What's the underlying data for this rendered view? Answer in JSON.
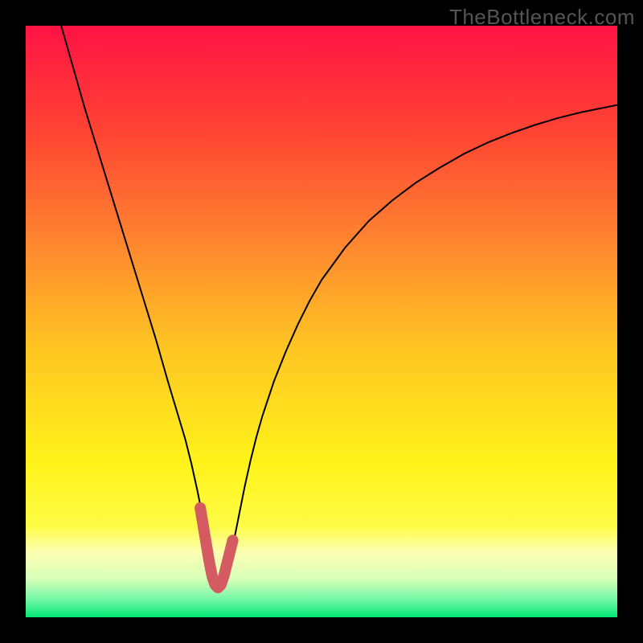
{
  "watermark": "TheBottleneck.com",
  "chart_data": {
    "type": "line",
    "title": "",
    "xlabel": "",
    "ylabel": "",
    "xlim": [
      0,
      100
    ],
    "ylim": [
      0,
      100
    ],
    "grid": false,
    "legend": false,
    "series": [
      {
        "name": "curve",
        "color": "#000000",
        "stroke_width": 2,
        "x": [
          6,
          8,
          10,
          12,
          14,
          16,
          18,
          20,
          22,
          24,
          25.8,
          27,
          28,
          29,
          30,
          30.8,
          31.6,
          32.4,
          33.2,
          34,
          35,
          36,
          37,
          38,
          39,
          40,
          42,
          44,
          46,
          48,
          50,
          54,
          58,
          62,
          66,
          70,
          74,
          78,
          82,
          86,
          90,
          94,
          98,
          100
        ],
        "y": [
          100,
          93,
          86,
          79.5,
          73,
          66.5,
          60,
          53.5,
          47,
          40,
          34,
          30,
          26,
          21.5,
          16.5,
          11.5,
          7,
          5,
          5.2,
          7.5,
          12,
          17,
          22,
          26.5,
          30.5,
          34,
          40,
          45,
          49.5,
          53.5,
          57,
          62.5,
          67,
          70.5,
          73.5,
          76,
          78.3,
          80.2,
          81.8,
          83.2,
          84.4,
          85.4,
          86.2,
          86.6
        ]
      },
      {
        "name": "highlight",
        "color": "#d45b61",
        "stroke_width": 14,
        "linecap": "round",
        "x": [
          29.5,
          30.0,
          30.5,
          31.0,
          31.5,
          32.0,
          32.5,
          33.0,
          33.5,
          34.0,
          34.5,
          35.0
        ],
        "y": [
          18.5,
          15.5,
          12.5,
          9.5,
          7.0,
          5.5,
          5.0,
          5.5,
          7.0,
          9.0,
          11.0,
          13.0
        ]
      }
    ],
    "background_gradient": {
      "stops": [
        {
          "offset": 0,
          "color": "#ff1244"
        },
        {
          "offset": 0.18,
          "color": "#ff4433"
        },
        {
          "offset": 0.35,
          "color": "#ff8030"
        },
        {
          "offset": 0.54,
          "color": "#ffc423"
        },
        {
          "offset": 0.74,
          "color": "#fff31a"
        },
        {
          "offset": 0.845,
          "color": "#fffc45"
        },
        {
          "offset": 0.89,
          "color": "#fdffb2"
        },
        {
          "offset": 0.935,
          "color": "#d7ffb8"
        },
        {
          "offset": 0.97,
          "color": "#74f7a7"
        },
        {
          "offset": 1.0,
          "color": "#00e874"
        }
      ]
    }
  }
}
